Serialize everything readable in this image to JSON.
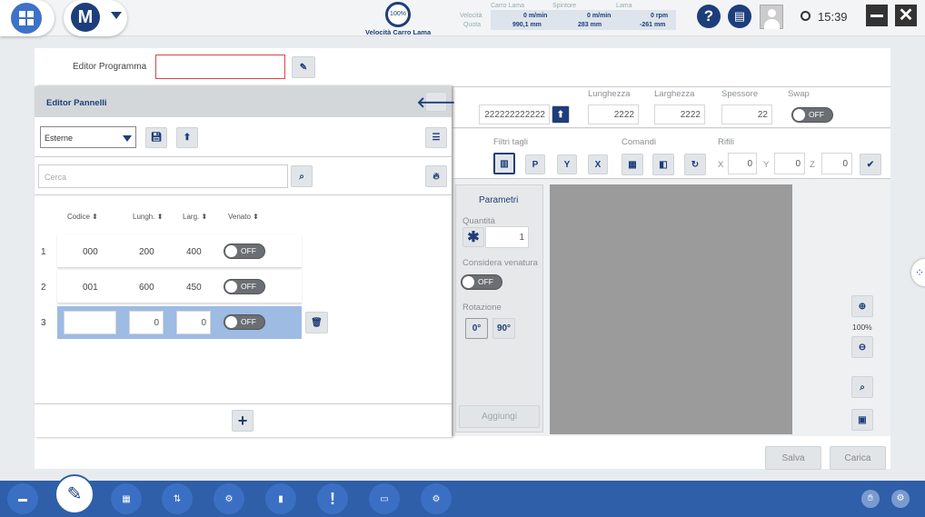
{
  "header": {
    "gauge_label": "100%",
    "gauge_caption": "Velocità Carro Lama",
    "readouts": {
      "col1": "Carro Lama",
      "col2": "Spintore",
      "col3": "Lama",
      "row1_label": "Velocità",
      "row2_label": "Quota",
      "v1": "0 m/min",
      "v2": "0 m/min",
      "v3": "0 rpm",
      "q1": "990,1 mm",
      "q2": "283 mm",
      "q3": "-261 mm"
    },
    "time": "15:39"
  },
  "editor": {
    "label": "Editor Programma",
    "value": ""
  },
  "panel": {
    "title": "Editor Pannelli",
    "select_value": "Esterne",
    "search_placeholder": "Cerca",
    "columns": [
      "Codice",
      "Lungh.",
      "Larg.",
      "Venato"
    ],
    "rows": [
      {
        "n": "1",
        "code": "000",
        "len": "200",
        "wid": "400",
        "toggle": "OFF"
      },
      {
        "n": "2",
        "code": "001",
        "len": "600",
        "wid": "450",
        "toggle": "OFF"
      }
    ],
    "edit_row": {
      "n": "3",
      "code": "",
      "len": "0",
      "wid": "0",
      "toggle": "OFF"
    }
  },
  "top": {
    "program_value": "222222222222",
    "lunghezza_label": "Lunghezza",
    "lunghezza": "2222",
    "larghezza_label": "Larghezza",
    "larghezza": "2222",
    "spessore_label": "Spessore",
    "spessore": "22",
    "swap_label": "Swap",
    "swap": "OFF"
  },
  "filters": {
    "label": "Filtri tagli",
    "p": "P",
    "y": "Y",
    "x": "X",
    "comandi": "Comandi",
    "rifili": "Rifili",
    "rx": "X",
    "ry": "Y",
    "rz": "Z",
    "vx": "0",
    "vy": "0",
    "vz": "0"
  },
  "params": {
    "title": "Parametri",
    "qty_label": "Quantità",
    "qty": "1",
    "venatura_label": "Considera venatura",
    "venatura": "OFF",
    "rot_label": "Rotazione",
    "rot0": "0°",
    "rot90": "90°",
    "add": "Aggiungi"
  },
  "zoom": "100%",
  "actions": {
    "save": "Salva",
    "load": "Carica"
  }
}
